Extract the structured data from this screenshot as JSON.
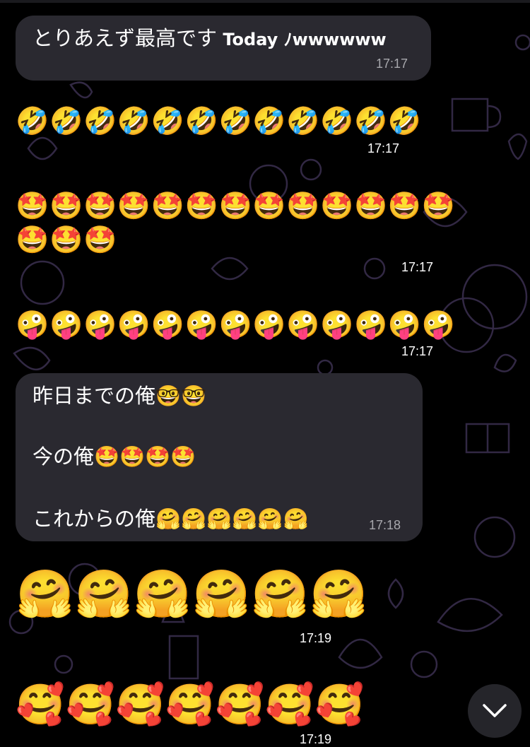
{
  "messages": [
    {
      "id": "m1",
      "text_jp": "とりあえず最高です",
      "text_latin": " Today ﾉwwwwww",
      "time": "17:17"
    },
    {
      "id": "m2",
      "emoji": "🤣",
      "count": 12,
      "time": "17:17"
    },
    {
      "id": "m3",
      "emoji": "🤩",
      "count": 16,
      "time": "17:17"
    },
    {
      "id": "m4",
      "emoji": "🤪",
      "count": 13,
      "time": "17:17"
    },
    {
      "id": "m5",
      "line1": "昨日までの俺🤓🤓",
      "line2": "今の俺🤩🤩🤩🤩",
      "line3": "これからの俺🤗🤗🤗🤗🤗🤗",
      "time": "17:18"
    },
    {
      "id": "m6",
      "emoji": "🤗",
      "count": 6,
      "time": "17:19"
    },
    {
      "id": "m7",
      "emoji": "🥰",
      "count": 7,
      "time": "17:19"
    }
  ],
  "controls": {
    "scroll_down_icon": "chevron-down-icon"
  },
  "colors": {
    "background": "#000000",
    "bubble": "#2a2930",
    "pattern": "#3a2f4a",
    "time_in_bubble": "#a8a8ad"
  }
}
